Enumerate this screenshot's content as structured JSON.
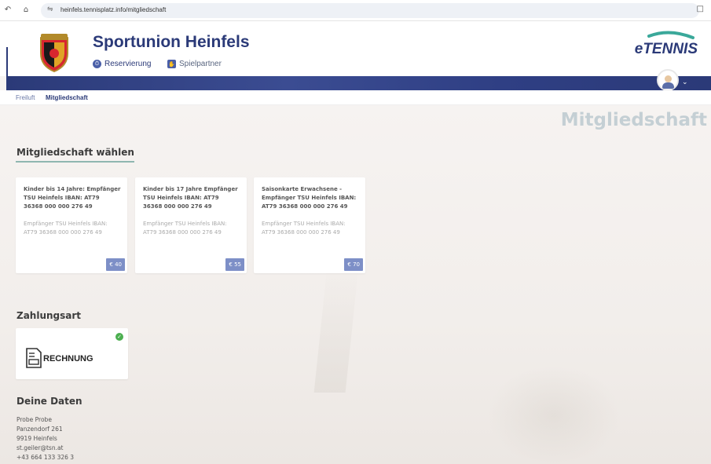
{
  "browser": {
    "back_icon": "back-arrow-icon",
    "home_icon": "home-icon",
    "url": "heinfels.tennisplatz.info/mitgliedschaft",
    "tune_icon": "site-settings-icon",
    "extension_icon": "extension-icon"
  },
  "header": {
    "club_name": "Sportunion Heinfels",
    "logo_text": "TSU HEINFELS",
    "nav": [
      {
        "label": "Reservierung",
        "icon": "clock-icon"
      },
      {
        "label": "Spielpartner",
        "icon": "handshake-icon"
      }
    ],
    "brand": "eTENNIS",
    "brand_color": "#2b3a78",
    "avatar_icon": "user-avatar-icon"
  },
  "breadcrumb": [
    "Freiluft",
    "Mitgliedschaft"
  ],
  "page_title": "Mitgliedschaft",
  "membership": {
    "section_title": "Mitgliedschaft wählen",
    "cards": [
      {
        "title_lines": [
          "Kinder bis 14 Jahre: Empfänger",
          "TSU Heinfels IBAN: AT79",
          "36368 000 000 276 49"
        ],
        "desc_lines": [
          "Empfänger TSU Heinfels IBAN:",
          "AT79 36368 000 000 276 49"
        ],
        "price": "€ 40"
      },
      {
        "title_lines": [
          "Kinder bis 17 Jahre Empfänger",
          "TSU Heinfels IBAN: AT79",
          "36368 000 000 276 49"
        ],
        "desc_lines": [
          "Empfänger TSU Heinfels IBAN:",
          "AT79 36368 000 000 276 49"
        ],
        "price": "€ 55"
      },
      {
        "title_lines": [
          "Saisonkarte Erwachsene -",
          "Empfänger TSU Heinfels IBAN:",
          "AT79 36368 000 000 276 49"
        ],
        "desc_lines": [
          "Empfänger TSU Heinfels IBAN:",
          "AT79 36368 000 000 276 49"
        ],
        "price": "€ 70"
      }
    ]
  },
  "payment": {
    "section_title": "Zahlungsart",
    "option_label": "RECHNUNG",
    "option_icon": "invoice-icon",
    "selected_icon": "check-circle-icon",
    "selected_color": "#4caf50"
  },
  "user_data": {
    "section_title": "Deine Daten",
    "lines": [
      "Probe Probe",
      "Panzendorf 261",
      "9919 Heinfels",
      "st.geiler@tsn.at",
      "+43 664 133 326 3"
    ]
  }
}
